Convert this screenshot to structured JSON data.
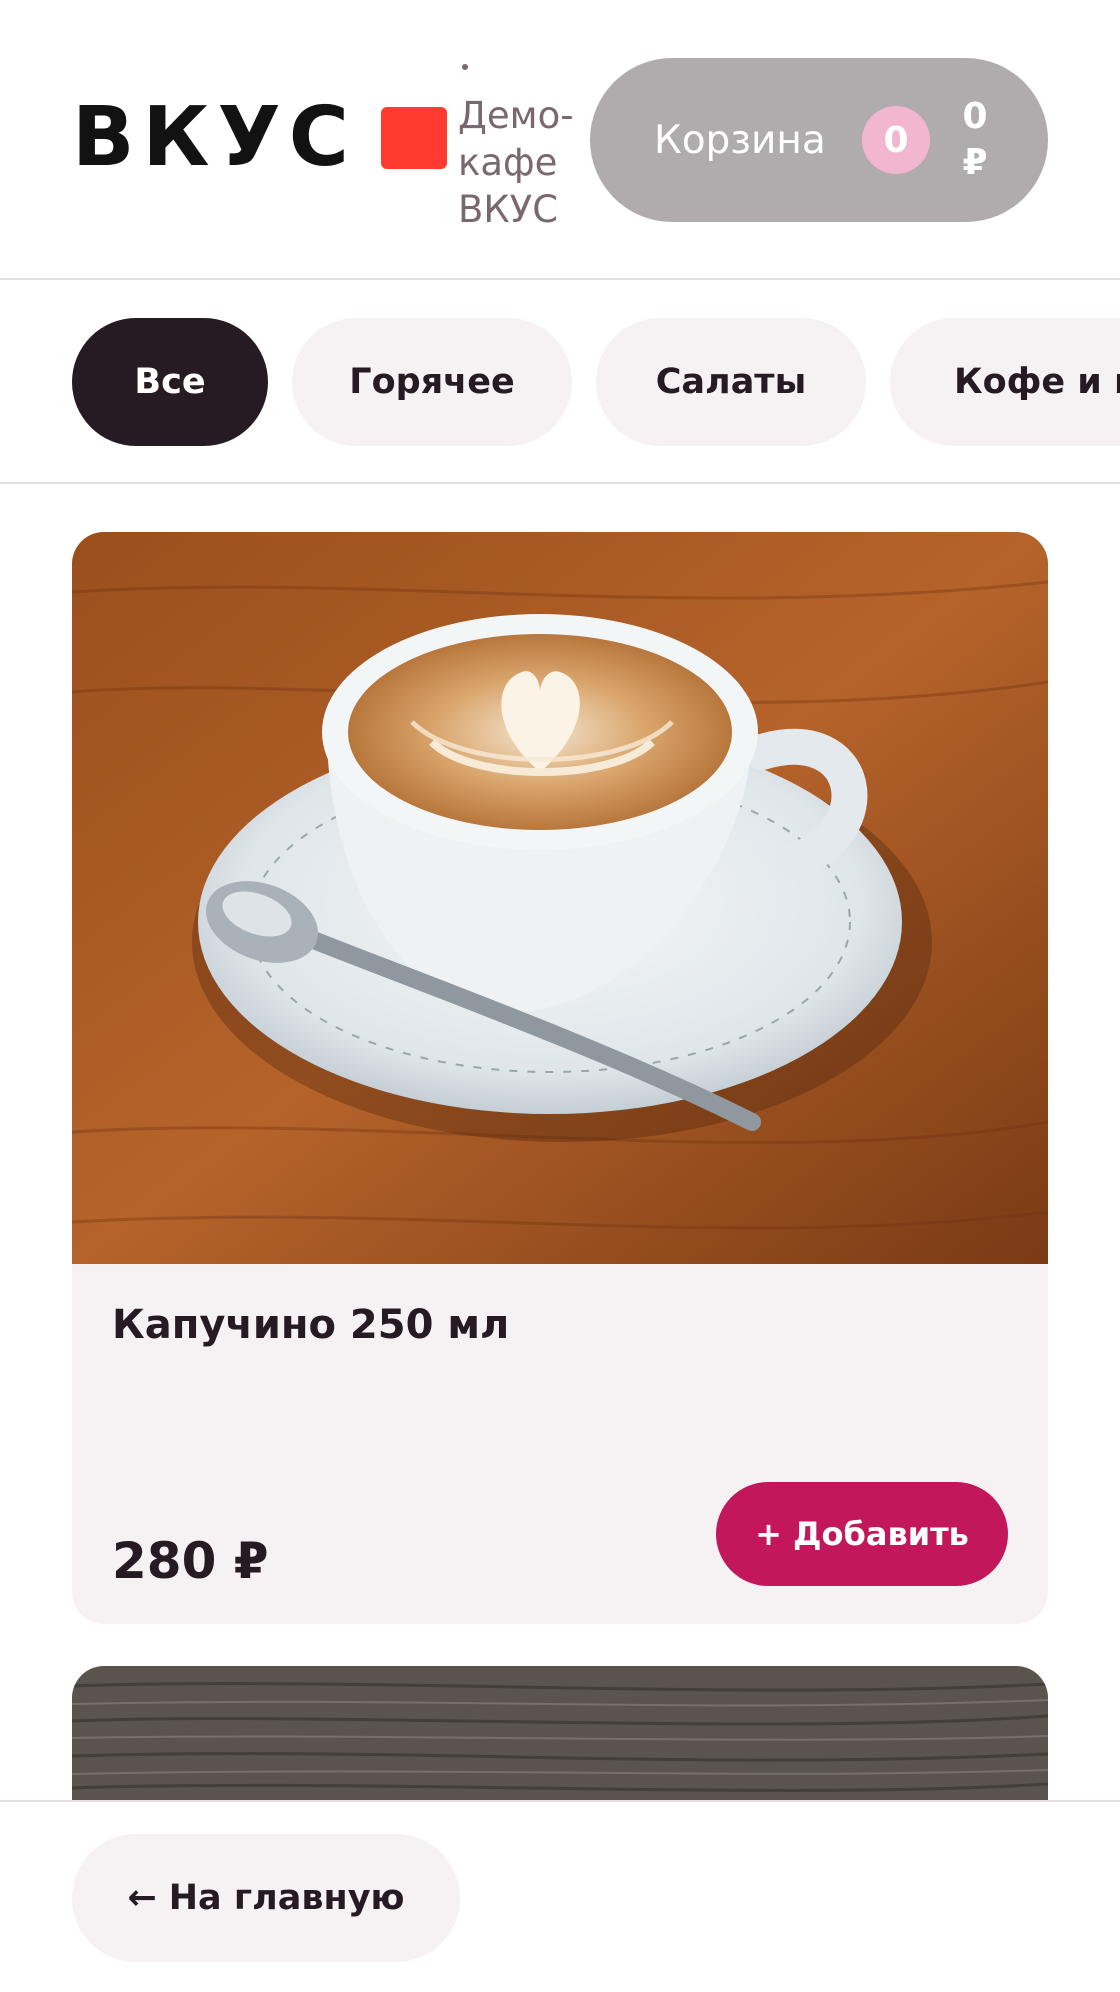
{
  "header": {
    "logo_text": "ВКУС",
    "cafe_name": "Демо-кафе ВКУС",
    "cart": {
      "label": "Корзина",
      "count": "0",
      "total_value": "0",
      "total_currency": "₽"
    }
  },
  "categories": [
    {
      "label": "Все",
      "active": true
    },
    {
      "label": "Горячее",
      "active": false
    },
    {
      "label": "Салаты",
      "active": false
    },
    {
      "label": "Кофе и напитки",
      "active": false
    }
  ],
  "products": [
    {
      "title": "Капучино 250 мл",
      "price": "280 ₽",
      "add_label": "+ Добавить",
      "image": "cappuccino-photo"
    }
  ],
  "footer": {
    "home_arrow": "←",
    "home_label": "На главную"
  },
  "colors": {
    "brand_red": "#ff3b30",
    "accent": "#c2185b",
    "chip_bg": "#f6f1f3",
    "active_chip": "#261b22",
    "cart_bg": "#b0acad"
  }
}
